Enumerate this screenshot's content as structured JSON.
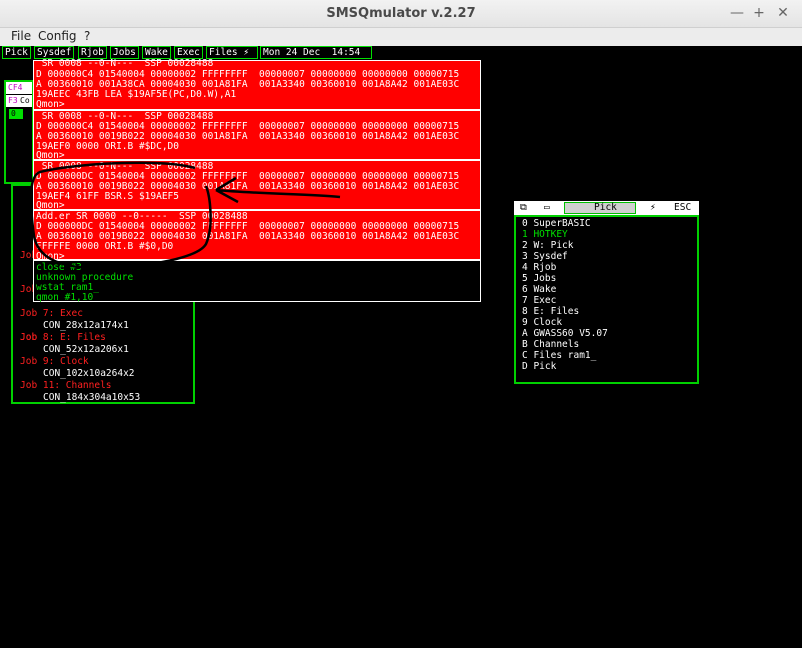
{
  "window": {
    "title": "SMSQmulator v.2.27",
    "minimize": "—",
    "maximize": "+",
    "close": "✕"
  },
  "menu": {
    "file": "File",
    "config": "Config",
    "help": "?"
  },
  "pickbar": {
    "items": [
      "Pick",
      "Sysdef",
      "Rjob",
      "Jobs",
      "Wake",
      "Exec",
      "Files"
    ],
    "clock": "Mon 24 Dec  14:54"
  },
  "behind": {
    "f4": "CF4",
    "f3": "F3",
    "co": "Co",
    "zero": "0"
  },
  "monitor": {
    "lines": [
      " SR 0008 --0-N---  SSP 00028488",
      "D 000000C4 01540004 00000002 FFFFFFFF  00000007 00000000 00000000 00000715",
      "A 00360010 001A38CA 00004030 001A81FA  001A3340 00360010 001A8A42 001AE03C",
      "19AEEC 43FB LEA $19AF5E(PC,D0.W),A1",
      "Qmon>",
      " SR 0008 --0-N---  SSP 00028488",
      "D 000000C4 01540004 00000002 FFFFFFFF  00000007 00000000 00000000 00000715",
      "A 00360010 0019B022 00004030 001A81FA  001A3340 00360010 001A8A42 001AE03C",
      "19AEF0 0000 ORI.B #$DC,D0",
      "Qmon>",
      " SR 0008 --0-N---  SSP 00028488",
      "D 000000DC 01540004 00000002 FFFFFFFF  00000007 00000000 00000000 00000715",
      "A 00360010 0019B022 00004030 001A81FA  001A3340 00360010 001A8A42 001AE03C",
      "19AEF4 61FF BSR.S $19AEF5",
      "Qmon>",
      "Add.er SR 0000 --0-----  SSP 00028488",
      "D 000000DC 01540004 00000002 FFFFFFFF  00000007 00000000 00000000 00000715",
      "A 00360010 0019B022 00004030 001A81FA  001A3340 00360010 001A8A42 001AE03C",
      "FFFFFE 0000 ORI.B #$0,D0",
      "Qmon>"
    ]
  },
  "commands": [
    "close #3",
    "unknown procedure",
    "wstat ram1_",
    "qmon #1,10"
  ],
  "jobs": {
    "partial": [
      "Job",
      "Job",
      "Job"
    ],
    "rows": [
      {
        "name": "Job 7: Exec",
        "con": "CON_28x12a174x1"
      },
      {
        "name": "Job 8: E: Files",
        "con": "CON_52x12a206x1"
      },
      {
        "name": "Job 9: Clock",
        "con": "CON_102x10a264x2"
      },
      {
        "name": "Job 11: Channels",
        "con": "CON_184x304a10x53"
      }
    ]
  },
  "pick": {
    "title": "Pick",
    "esc": "ESC",
    "items": [
      "0 SuperBASIC",
      "1 HOTKEY",
      "2 W: Pick",
      "3 Sysdef",
      "4 Rjob",
      "5 Jobs",
      "6 Wake",
      "7 Exec",
      "8 E: Files",
      "9 Clock",
      "A GWASS60 V5.07",
      "B Channels",
      "C Files ram1_",
      "D Pick"
    ],
    "selected_index": 1
  },
  "colors": {
    "accent": "#00d000",
    "monitor_bg": "#ff0000",
    "screen_bg": "#000000"
  }
}
